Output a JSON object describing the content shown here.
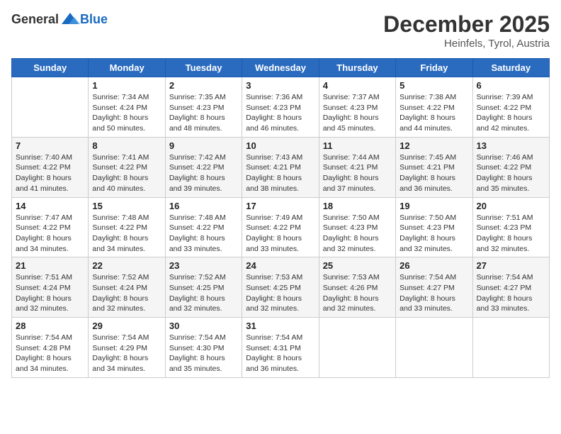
{
  "header": {
    "logo_general": "General",
    "logo_blue": "Blue",
    "month": "December 2025",
    "location": "Heinfels, Tyrol, Austria"
  },
  "weekdays": [
    "Sunday",
    "Monday",
    "Tuesday",
    "Wednesday",
    "Thursday",
    "Friday",
    "Saturday"
  ],
  "weeks": [
    [
      {
        "day": "",
        "sunrise": "",
        "sunset": "",
        "daylight": ""
      },
      {
        "day": "1",
        "sunrise": "Sunrise: 7:34 AM",
        "sunset": "Sunset: 4:24 PM",
        "daylight": "Daylight: 8 hours and 50 minutes."
      },
      {
        "day": "2",
        "sunrise": "Sunrise: 7:35 AM",
        "sunset": "Sunset: 4:23 PM",
        "daylight": "Daylight: 8 hours and 48 minutes."
      },
      {
        "day": "3",
        "sunrise": "Sunrise: 7:36 AM",
        "sunset": "Sunset: 4:23 PM",
        "daylight": "Daylight: 8 hours and 46 minutes."
      },
      {
        "day": "4",
        "sunrise": "Sunrise: 7:37 AM",
        "sunset": "Sunset: 4:23 PM",
        "daylight": "Daylight: 8 hours and 45 minutes."
      },
      {
        "day": "5",
        "sunrise": "Sunrise: 7:38 AM",
        "sunset": "Sunset: 4:22 PM",
        "daylight": "Daylight: 8 hours and 44 minutes."
      },
      {
        "day": "6",
        "sunrise": "Sunrise: 7:39 AM",
        "sunset": "Sunset: 4:22 PM",
        "daylight": "Daylight: 8 hours and 42 minutes."
      }
    ],
    [
      {
        "day": "7",
        "sunrise": "Sunrise: 7:40 AM",
        "sunset": "Sunset: 4:22 PM",
        "daylight": "Daylight: 8 hours and 41 minutes."
      },
      {
        "day": "8",
        "sunrise": "Sunrise: 7:41 AM",
        "sunset": "Sunset: 4:22 PM",
        "daylight": "Daylight: 8 hours and 40 minutes."
      },
      {
        "day": "9",
        "sunrise": "Sunrise: 7:42 AM",
        "sunset": "Sunset: 4:22 PM",
        "daylight": "Daylight: 8 hours and 39 minutes."
      },
      {
        "day": "10",
        "sunrise": "Sunrise: 7:43 AM",
        "sunset": "Sunset: 4:21 PM",
        "daylight": "Daylight: 8 hours and 38 minutes."
      },
      {
        "day": "11",
        "sunrise": "Sunrise: 7:44 AM",
        "sunset": "Sunset: 4:21 PM",
        "daylight": "Daylight: 8 hours and 37 minutes."
      },
      {
        "day": "12",
        "sunrise": "Sunrise: 7:45 AM",
        "sunset": "Sunset: 4:21 PM",
        "daylight": "Daylight: 8 hours and 36 minutes."
      },
      {
        "day": "13",
        "sunrise": "Sunrise: 7:46 AM",
        "sunset": "Sunset: 4:22 PM",
        "daylight": "Daylight: 8 hours and 35 minutes."
      }
    ],
    [
      {
        "day": "14",
        "sunrise": "Sunrise: 7:47 AM",
        "sunset": "Sunset: 4:22 PM",
        "daylight": "Daylight: 8 hours and 34 minutes."
      },
      {
        "day": "15",
        "sunrise": "Sunrise: 7:48 AM",
        "sunset": "Sunset: 4:22 PM",
        "daylight": "Daylight: 8 hours and 34 minutes."
      },
      {
        "day": "16",
        "sunrise": "Sunrise: 7:48 AM",
        "sunset": "Sunset: 4:22 PM",
        "daylight": "Daylight: 8 hours and 33 minutes."
      },
      {
        "day": "17",
        "sunrise": "Sunrise: 7:49 AM",
        "sunset": "Sunset: 4:22 PM",
        "daylight": "Daylight: 8 hours and 33 minutes."
      },
      {
        "day": "18",
        "sunrise": "Sunrise: 7:50 AM",
        "sunset": "Sunset: 4:23 PM",
        "daylight": "Daylight: 8 hours and 32 minutes."
      },
      {
        "day": "19",
        "sunrise": "Sunrise: 7:50 AM",
        "sunset": "Sunset: 4:23 PM",
        "daylight": "Daylight: 8 hours and 32 minutes."
      },
      {
        "day": "20",
        "sunrise": "Sunrise: 7:51 AM",
        "sunset": "Sunset: 4:23 PM",
        "daylight": "Daylight: 8 hours and 32 minutes."
      }
    ],
    [
      {
        "day": "21",
        "sunrise": "Sunrise: 7:51 AM",
        "sunset": "Sunset: 4:24 PM",
        "daylight": "Daylight: 8 hours and 32 minutes."
      },
      {
        "day": "22",
        "sunrise": "Sunrise: 7:52 AM",
        "sunset": "Sunset: 4:24 PM",
        "daylight": "Daylight: 8 hours and 32 minutes."
      },
      {
        "day": "23",
        "sunrise": "Sunrise: 7:52 AM",
        "sunset": "Sunset: 4:25 PM",
        "daylight": "Daylight: 8 hours and 32 minutes."
      },
      {
        "day": "24",
        "sunrise": "Sunrise: 7:53 AM",
        "sunset": "Sunset: 4:25 PM",
        "daylight": "Daylight: 8 hours and 32 minutes."
      },
      {
        "day": "25",
        "sunrise": "Sunrise: 7:53 AM",
        "sunset": "Sunset: 4:26 PM",
        "daylight": "Daylight: 8 hours and 32 minutes."
      },
      {
        "day": "26",
        "sunrise": "Sunrise: 7:54 AM",
        "sunset": "Sunset: 4:27 PM",
        "daylight": "Daylight: 8 hours and 33 minutes."
      },
      {
        "day": "27",
        "sunrise": "Sunrise: 7:54 AM",
        "sunset": "Sunset: 4:27 PM",
        "daylight": "Daylight: 8 hours and 33 minutes."
      }
    ],
    [
      {
        "day": "28",
        "sunrise": "Sunrise: 7:54 AM",
        "sunset": "Sunset: 4:28 PM",
        "daylight": "Daylight: 8 hours and 34 minutes."
      },
      {
        "day": "29",
        "sunrise": "Sunrise: 7:54 AM",
        "sunset": "Sunset: 4:29 PM",
        "daylight": "Daylight: 8 hours and 34 minutes."
      },
      {
        "day": "30",
        "sunrise": "Sunrise: 7:54 AM",
        "sunset": "Sunset: 4:30 PM",
        "daylight": "Daylight: 8 hours and 35 minutes."
      },
      {
        "day": "31",
        "sunrise": "Sunrise: 7:54 AM",
        "sunset": "Sunset: 4:31 PM",
        "daylight": "Daylight: 8 hours and 36 minutes."
      },
      {
        "day": "",
        "sunrise": "",
        "sunset": "",
        "daylight": ""
      },
      {
        "day": "",
        "sunrise": "",
        "sunset": "",
        "daylight": ""
      },
      {
        "day": "",
        "sunrise": "",
        "sunset": "",
        "daylight": ""
      }
    ]
  ]
}
